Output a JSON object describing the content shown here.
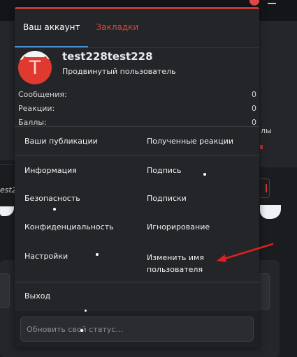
{
  "account_menu": {
    "tabs": [
      {
        "label": "Ваш аккаунт",
        "active": true
      },
      {
        "label": "Закладки",
        "active": false
      }
    ],
    "profile": {
      "avatar_letter": "T",
      "username": "test228test228",
      "user_title": "Продвинутый пользователь",
      "stats": [
        {
          "label": "Сообщения:",
          "value": "0"
        },
        {
          "label": "Реакции:",
          "value": "0"
        },
        {
          "label": "Баллы:",
          "value": "0"
        }
      ]
    },
    "links": {
      "your_posts": "Ваши публикации",
      "reactions_received": "Полученные реакции",
      "information": "Информация",
      "signature": "Подпись",
      "security": "Безопасность",
      "following": "Подписки",
      "privacy": "Конфиденциальность",
      "ignoring": "Игнорирование",
      "settings": "Настройки",
      "change_username": "Изменить имя пользователя"
    },
    "logout": "Выход",
    "status_placeholder": "Обновить свой статус..."
  },
  "background": {
    "left_text": "est2",
    "right_text": "лы"
  },
  "colors": {
    "accent_red": "#d9453d",
    "active_tab_underline": "#4b8fd8",
    "panel_bg": "#242529",
    "avatar_bg": "#e0392f",
    "annotation_arrow": "#e02020"
  },
  "icons": [
    "avatar-icon",
    "menu-icon",
    "arrow-annotation-icon"
  ]
}
